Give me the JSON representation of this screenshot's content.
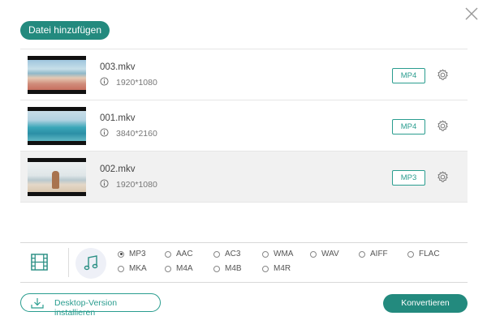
{
  "dialog": {
    "add_file_label": "Datei hinzufügen",
    "close_icon": "close-icon"
  },
  "files": [
    {
      "name": "003.mkv",
      "resolution": "1920*1080",
      "format": "MP4",
      "selected": false
    },
    {
      "name": "001.mkv",
      "resolution": "3840*2160",
      "format": "MP4",
      "selected": false
    },
    {
      "name": "002.mkv",
      "resolution": "1920*1080",
      "format": "MP3",
      "selected": true
    }
  ],
  "format_panel": {
    "video_tab_icon": "film-icon",
    "audio_tab_icon": "music-note-icon",
    "selected": "MP3",
    "options": [
      "MP3",
      "AAC",
      "AC3",
      "WMA",
      "WAV",
      "AIFF",
      "FLAC",
      "MKA",
      "M4A",
      "M4B",
      "M4R"
    ]
  },
  "footer": {
    "install_label": "Desktop-Version installieren",
    "convert_label": "Konvertieren"
  },
  "colors": {
    "accent": "#238a7e",
    "accent_outline": "#2a9d8f"
  }
}
